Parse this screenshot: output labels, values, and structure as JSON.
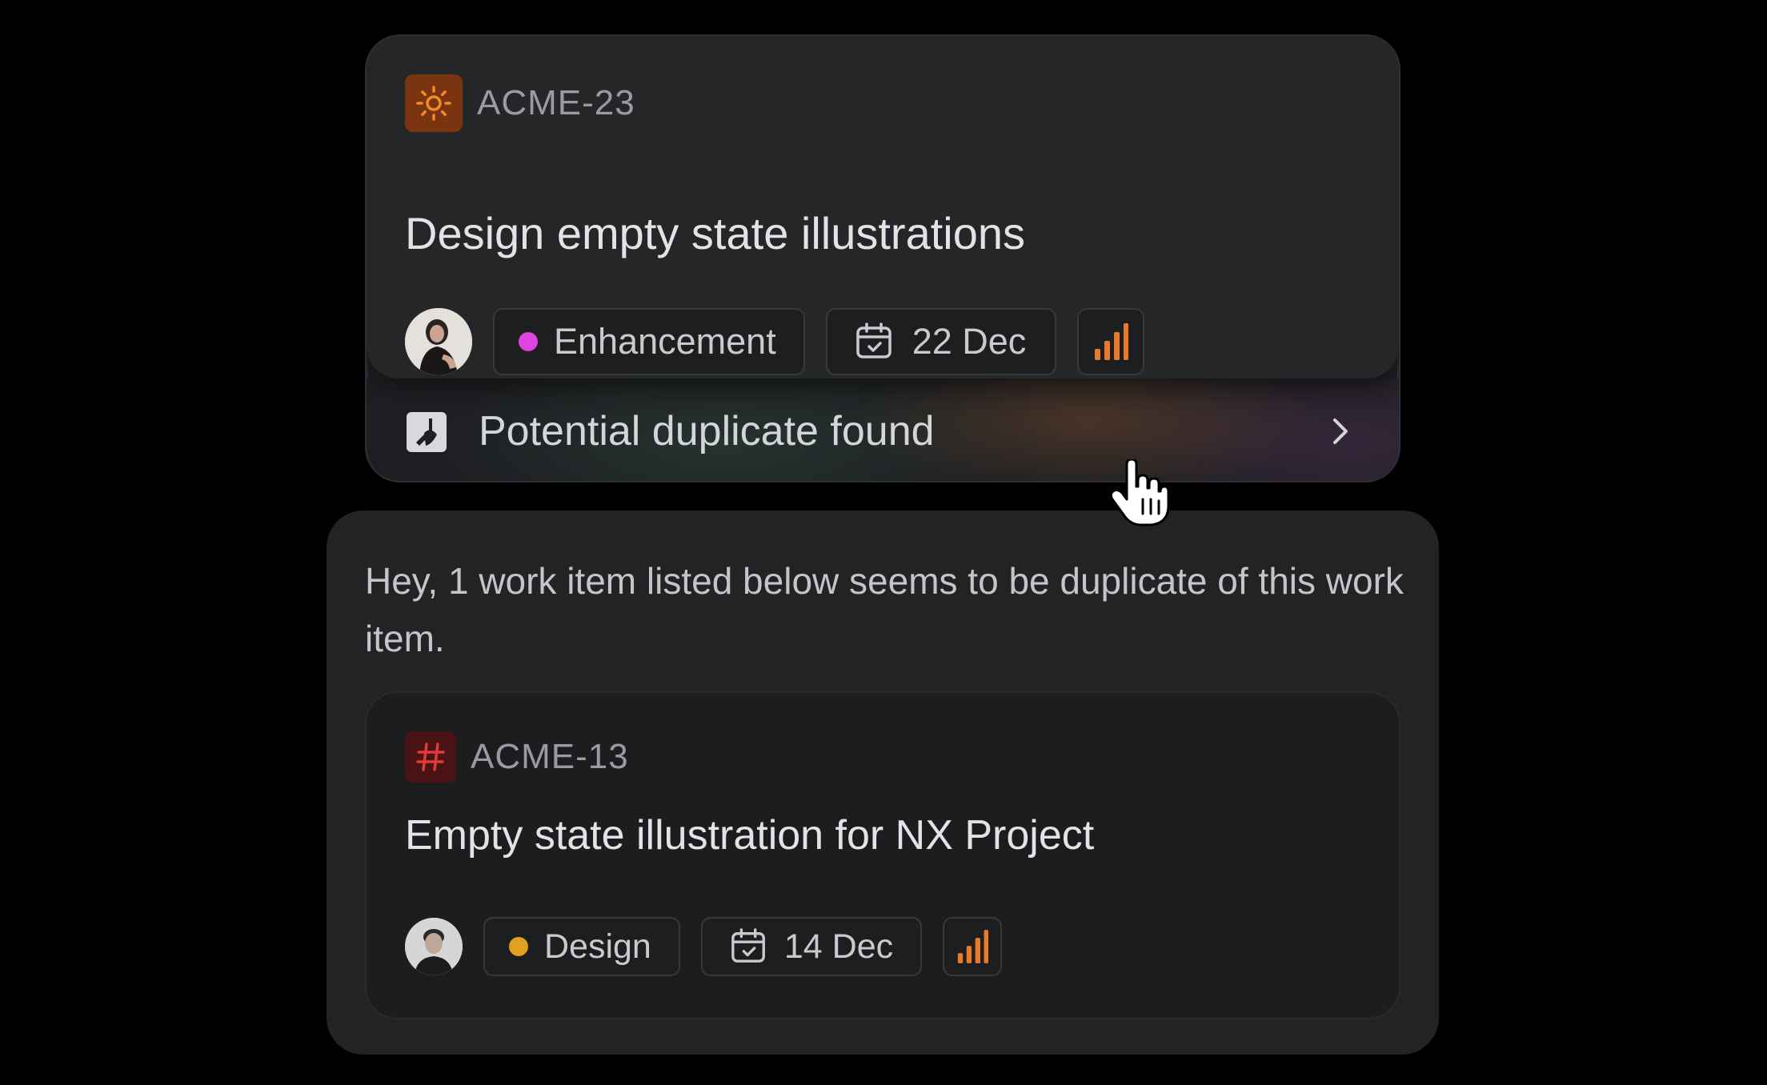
{
  "top_card": {
    "id": "ACME-23",
    "title": "Design empty state illustrations",
    "label": "Enhancement",
    "label_color": "#e044e0",
    "due_date": "22 Dec",
    "priority_icon": "priority-bars-icon",
    "priority_color": "#e87a2c",
    "type_icon": "sun-icon",
    "type_icon_color": "#f28a2c",
    "avatar": "avatar-woman"
  },
  "duplicate_bar": {
    "text": "Potential duplicate found",
    "icon": "duplicate-alert-icon"
  },
  "bottom_panel": {
    "message": "Hey, 1 work item listed below seems to be duplicate of this work item.",
    "card": {
      "id": "ACME-13",
      "title": "Empty state illustration for NX Project",
      "label": "Design",
      "label_color": "#e0a020",
      "due_date": "14 Dec",
      "priority_icon": "priority-bars-icon",
      "priority_color": "#e87a2c",
      "type_icon": "hash-icon",
      "type_icon_color": "#e03a3a",
      "avatar": "avatar-man"
    }
  }
}
